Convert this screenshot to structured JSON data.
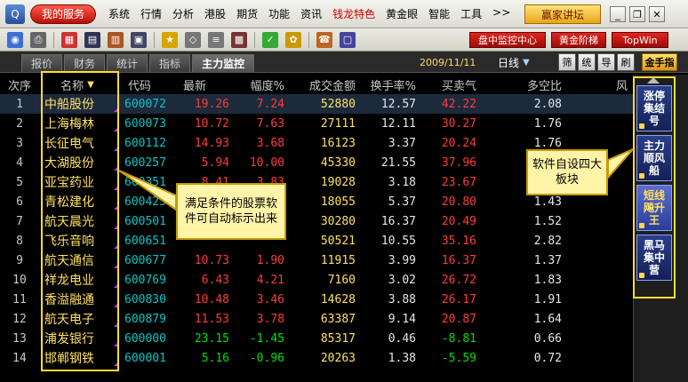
{
  "menubar": {
    "my_service": "我的服务",
    "items": [
      "系统",
      "行情",
      "分析",
      "港股",
      "期货",
      "功能",
      "资讯",
      "钱龙特色",
      "黄金眼",
      "智能",
      "工具",
      ">>"
    ],
    "expert": "赢家讲坛"
  },
  "toolbar": {
    "buttons": [
      "盘中监控中心",
      "黄金阶梯",
      "TopWin"
    ]
  },
  "tabs": [
    {
      "label": "报价"
    },
    {
      "label": "财务"
    },
    {
      "label": "统计"
    },
    {
      "label": "指标"
    },
    {
      "label": "主力监控"
    }
  ],
  "date": "2009/11/11",
  "period": "日线",
  "small_buttons": [
    "筛",
    "统",
    "导",
    "刷"
  ],
  "golden_btn": "金手指",
  "table": {
    "headers": [
      "次序",
      "名称",
      "代码",
      "最新",
      "幅度%",
      "成交金额",
      "换手率%",
      "买卖气",
      "多空比",
      "风"
    ],
    "rows": [
      {
        "idx": "1",
        "name": "中船股份",
        "code": "600072",
        "last": "19.26",
        "pct": "7.24",
        "amt": "52880",
        "turn": "12.57",
        "bs": "42.22",
        "ratio": "2.08",
        "dir": "up"
      },
      {
        "idx": "2",
        "name": "上海梅林",
        "code": "600073",
        "last": "10.72",
        "pct": "7.63",
        "amt": "27111",
        "turn": "12.11",
        "bs": "30.27",
        "ratio": "1.76",
        "dir": "up"
      },
      {
        "idx": "3",
        "name": "长征电气",
        "code": "600112",
        "last": "14.93",
        "pct": "3.68",
        "amt": "16123",
        "turn": "3.37",
        "bs": "20.24",
        "ratio": "1.76",
        "dir": "up"
      },
      {
        "idx": "4",
        "name": "大湖股份",
        "code": "600257",
        "last": "5.94",
        "pct": "10.00",
        "amt": "45330",
        "turn": "21.55",
        "bs": "37.96",
        "ratio": "",
        "dir": "up"
      },
      {
        "idx": "5",
        "name": "亚宝药业",
        "code": "600351",
        "last": "8.41",
        "pct": "3.83",
        "amt": "19028",
        "turn": "3.18",
        "bs": "23.67",
        "ratio": "",
        "dir": "up"
      },
      {
        "idx": "6",
        "name": "青松建化",
        "code": "600425",
        "last": "",
        "pct": "",
        "amt": "18055",
        "turn": "5.37",
        "bs": "20.80",
        "ratio": "1.43",
        "dir": "up"
      },
      {
        "idx": "7",
        "name": "航天晨光",
        "code": "600501",
        "last": "",
        "pct": "",
        "amt": "30280",
        "turn": "16.37",
        "bs": "20.49",
        "ratio": "1.52",
        "dir": "up"
      },
      {
        "idx": "8",
        "name": "飞乐音响",
        "code": "600651",
        "last": "",
        "pct": "",
        "amt": "50521",
        "turn": "10.55",
        "bs": "35.16",
        "ratio": "2.82",
        "dir": "up"
      },
      {
        "idx": "9",
        "name": "航天通信",
        "code": "600677",
        "last": "10.73",
        "pct": "1.90",
        "amt": "11915",
        "turn": "3.99",
        "bs": "16.37",
        "ratio": "1.37",
        "dir": "up"
      },
      {
        "idx": "10",
        "name": "祥龙电业",
        "code": "600769",
        "last": "6.43",
        "pct": "4.21",
        "amt": "7160",
        "turn": "3.02",
        "bs": "26.72",
        "ratio": "1.83",
        "dir": "up"
      },
      {
        "idx": "11",
        "name": "香溢融通",
        "code": "600830",
        "last": "10.48",
        "pct": "3.46",
        "amt": "14628",
        "turn": "3.88",
        "bs": "26.17",
        "ratio": "1.91",
        "dir": "up"
      },
      {
        "idx": "12",
        "name": "航天电子",
        "code": "600879",
        "last": "11.53",
        "pct": "3.78",
        "amt": "63387",
        "turn": "9.14",
        "bs": "20.87",
        "ratio": "1.64",
        "dir": "up"
      },
      {
        "idx": "13",
        "name": "浦发银行",
        "code": "600000",
        "last": "23.15",
        "pct": "-1.45",
        "amt": "85317",
        "turn": "0.46",
        "bs": "-8.81",
        "ratio": "0.66",
        "dir": "down"
      },
      {
        "idx": "14",
        "name": "邯郸钢铁",
        "code": "600001",
        "last": "5.16",
        "pct": "-0.96",
        "amt": "20263",
        "turn": "1.38",
        "bs": "-5.59",
        "ratio": "0.72",
        "dir": "down"
      }
    ]
  },
  "callouts": {
    "left": "满足条件的股票软件可自动标示出来",
    "right": "软件自设四大板块"
  },
  "side_buttons": [
    "涨停集结号",
    "主力顺风船",
    "短线飚升王",
    "黑马集中营"
  ]
}
